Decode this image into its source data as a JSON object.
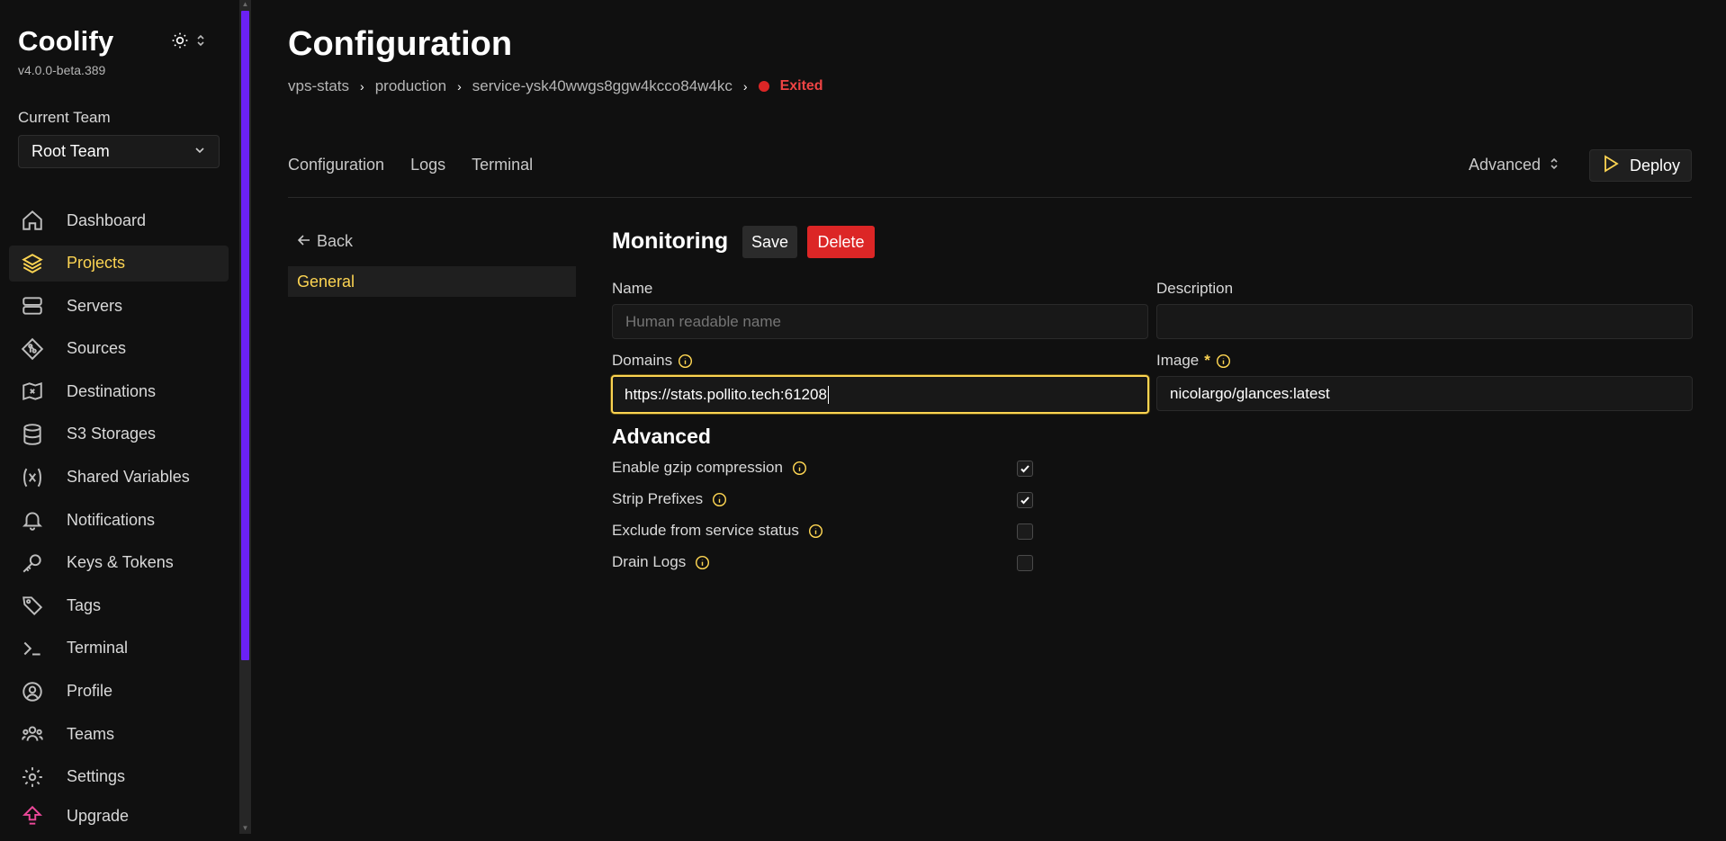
{
  "sidebar": {
    "brand": "Coolify",
    "version": "v4.0.0-beta.389",
    "team_label": "Current Team",
    "team_value": "Root Team",
    "items": [
      {
        "label": "Dashboard",
        "icon": "home-icon"
      },
      {
        "label": "Projects",
        "icon": "layers-icon"
      },
      {
        "label": "Servers",
        "icon": "server-icon"
      },
      {
        "label": "Sources",
        "icon": "git-icon"
      },
      {
        "label": "Destinations",
        "icon": "map-icon"
      },
      {
        "label": "S3 Storages",
        "icon": "database-icon"
      },
      {
        "label": "Shared Variables",
        "icon": "variable-icon"
      },
      {
        "label": "Notifications",
        "icon": "bell-icon"
      },
      {
        "label": "Keys & Tokens",
        "icon": "key-icon"
      },
      {
        "label": "Tags",
        "icon": "tag-icon"
      },
      {
        "label": "Terminal",
        "icon": "terminal-icon"
      },
      {
        "label": "Profile",
        "icon": "user-icon"
      },
      {
        "label": "Teams",
        "icon": "users-icon"
      },
      {
        "label": "Settings",
        "icon": "gear-icon"
      },
      {
        "label": "Upgrade",
        "icon": "upgrade-icon"
      }
    ],
    "active_item": "Projects"
  },
  "header": {
    "title": "Configuration",
    "breadcrumb": [
      "vps-stats",
      "production",
      "service-ysk40wwgs8ggw4kcco84w4kc"
    ],
    "status": "Exited"
  },
  "tabs": [
    "Configuration",
    "Logs",
    "Terminal"
  ],
  "advanced_dropdown": "Advanced",
  "deploy_label": "Deploy",
  "left_nav": {
    "back": "Back",
    "general": "General"
  },
  "form": {
    "title": "Monitoring",
    "save": "Save",
    "delete": "Delete",
    "name_label": "Name",
    "name_placeholder": "Human readable name",
    "description_label": "Description",
    "description_value": "",
    "domains_label": "Domains",
    "domains_value": "https://stats.pollito.tech:61208",
    "image_label": "Image",
    "image_required": "*",
    "image_value": "nicolargo/glances:latest",
    "advanced_title": "Advanced",
    "options": [
      {
        "label": "Enable gzip compression",
        "checked": true
      },
      {
        "label": "Strip Prefixes",
        "checked": true
      },
      {
        "label": "Exclude from service status",
        "checked": false
      },
      {
        "label": "Drain Logs",
        "checked": false
      }
    ]
  },
  "colors": {
    "accent": "#fcd452",
    "danger": "#dc2626",
    "scrollbar": "#6b21f5",
    "upgrade": "#ec4899"
  }
}
